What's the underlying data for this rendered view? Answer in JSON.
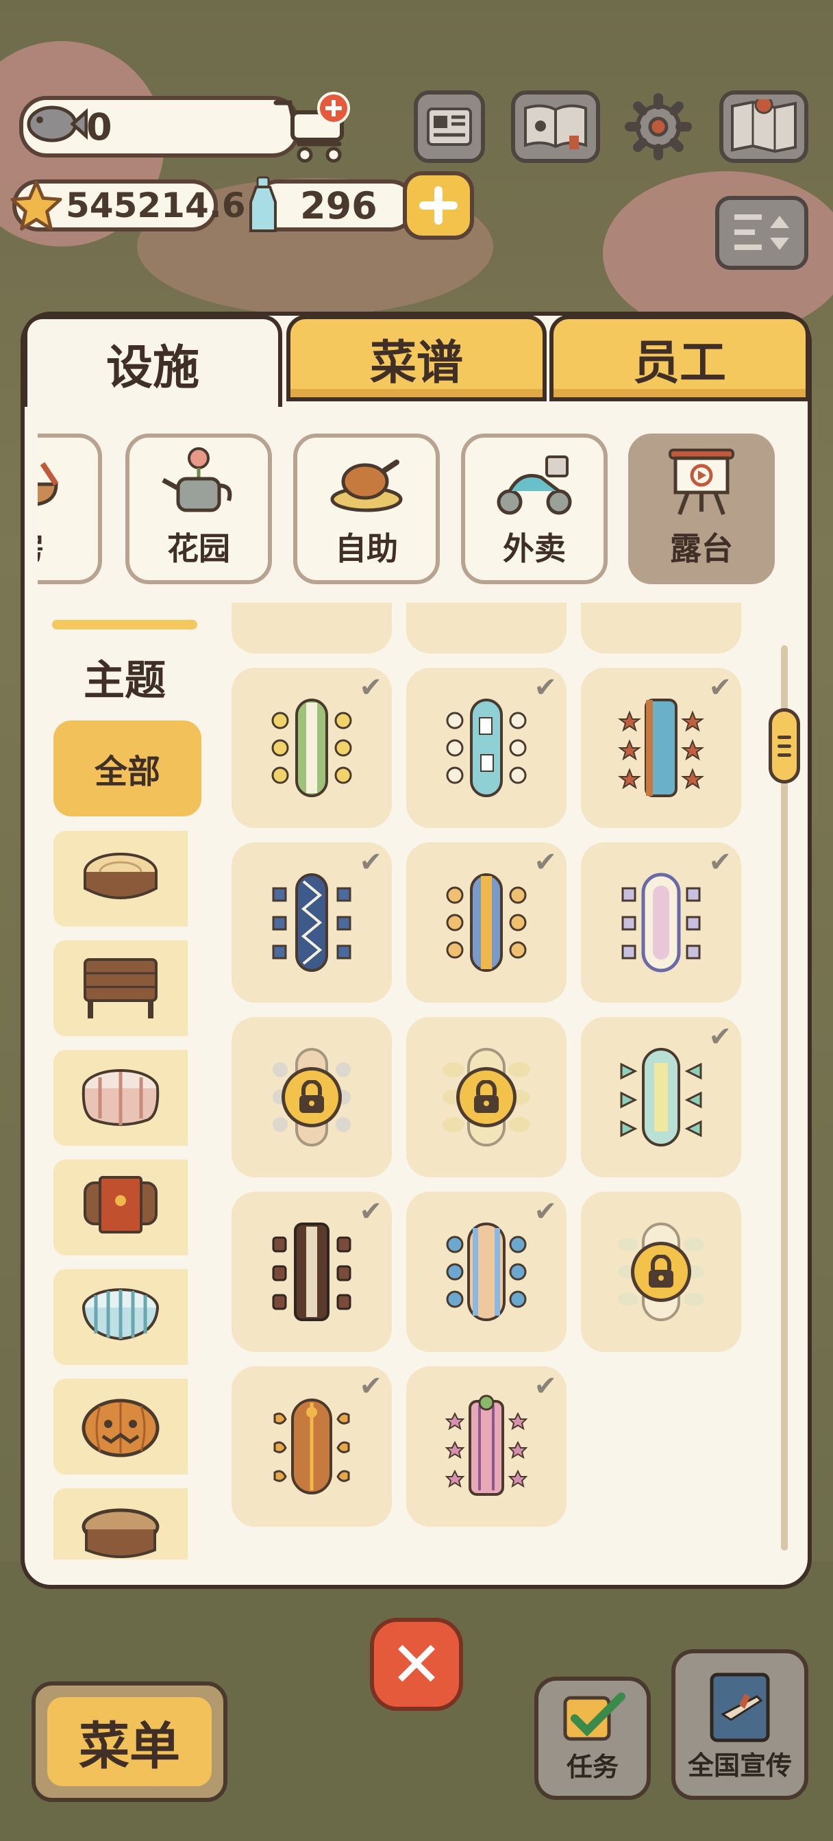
{
  "hud": {
    "fish_count": "0",
    "star_count": "545214.6",
    "bottle_count": "296"
  },
  "tabs": [
    {
      "label": "设施",
      "active": true
    },
    {
      "label": "菜谱",
      "active": false
    },
    {
      "label": "员工",
      "active": false
    }
  ],
  "categories": [
    {
      "label": "房",
      "icon": "kitchen-icon",
      "selected": false
    },
    {
      "label": "花园",
      "icon": "watering-can-icon",
      "selected": false
    },
    {
      "label": "自助",
      "icon": "roast-chicken-icon",
      "selected": false
    },
    {
      "label": "外卖",
      "icon": "scooter-icon",
      "selected": false
    },
    {
      "label": "露台",
      "icon": "easel-icon",
      "selected": true
    }
  ],
  "sidebar": {
    "title": "主题",
    "all_label": "全部",
    "themes": [
      "wood-stump-icon",
      "wood-crate-icon",
      "gingham-table-icon",
      "paw-rug-table-icon",
      "striped-table-icon",
      "pumpkin-icon",
      "round-wood-table-icon"
    ]
  },
  "tables": [
    {
      "theme": "green-garden",
      "owned": true,
      "locked": false
    },
    {
      "theme": "playing-cards",
      "owned": true,
      "locked": false
    },
    {
      "theme": "starfish-ocean",
      "owned": true,
      "locked": false
    },
    {
      "theme": "navy-lattice",
      "owned": true,
      "locked": false
    },
    {
      "theme": "honey-stripe",
      "owned": true,
      "locked": false
    },
    {
      "theme": "lavender-frame",
      "owned": true,
      "locked": false
    },
    {
      "theme": "flower-pastel",
      "owned": false,
      "locked": true
    },
    {
      "theme": "cream-cloud",
      "owned": false,
      "locked": true
    },
    {
      "theme": "mint-bow",
      "owned": true,
      "locked": false
    },
    {
      "theme": "dark-wood",
      "owned": true,
      "locked": false
    },
    {
      "theme": "peach-sky",
      "owned": true,
      "locked": false
    },
    {
      "theme": "white-porcelain",
      "owned": false,
      "locked": true
    },
    {
      "theme": "guitar-wood",
      "owned": true,
      "locked": false
    },
    {
      "theme": "sakura-pink",
      "owned": true,
      "locked": false
    }
  ],
  "bottom": {
    "menu_label": "菜单",
    "task_label": "任务",
    "promo_label": "全国宣传",
    "close_symbol": "✕"
  },
  "colors": {
    "accent_yellow": "#f4c85c",
    "panel_bg": "#faf5ea",
    "card_bg": "#f4e6c4",
    "close_red": "#e55a3a",
    "outline": "#3f2f26"
  }
}
